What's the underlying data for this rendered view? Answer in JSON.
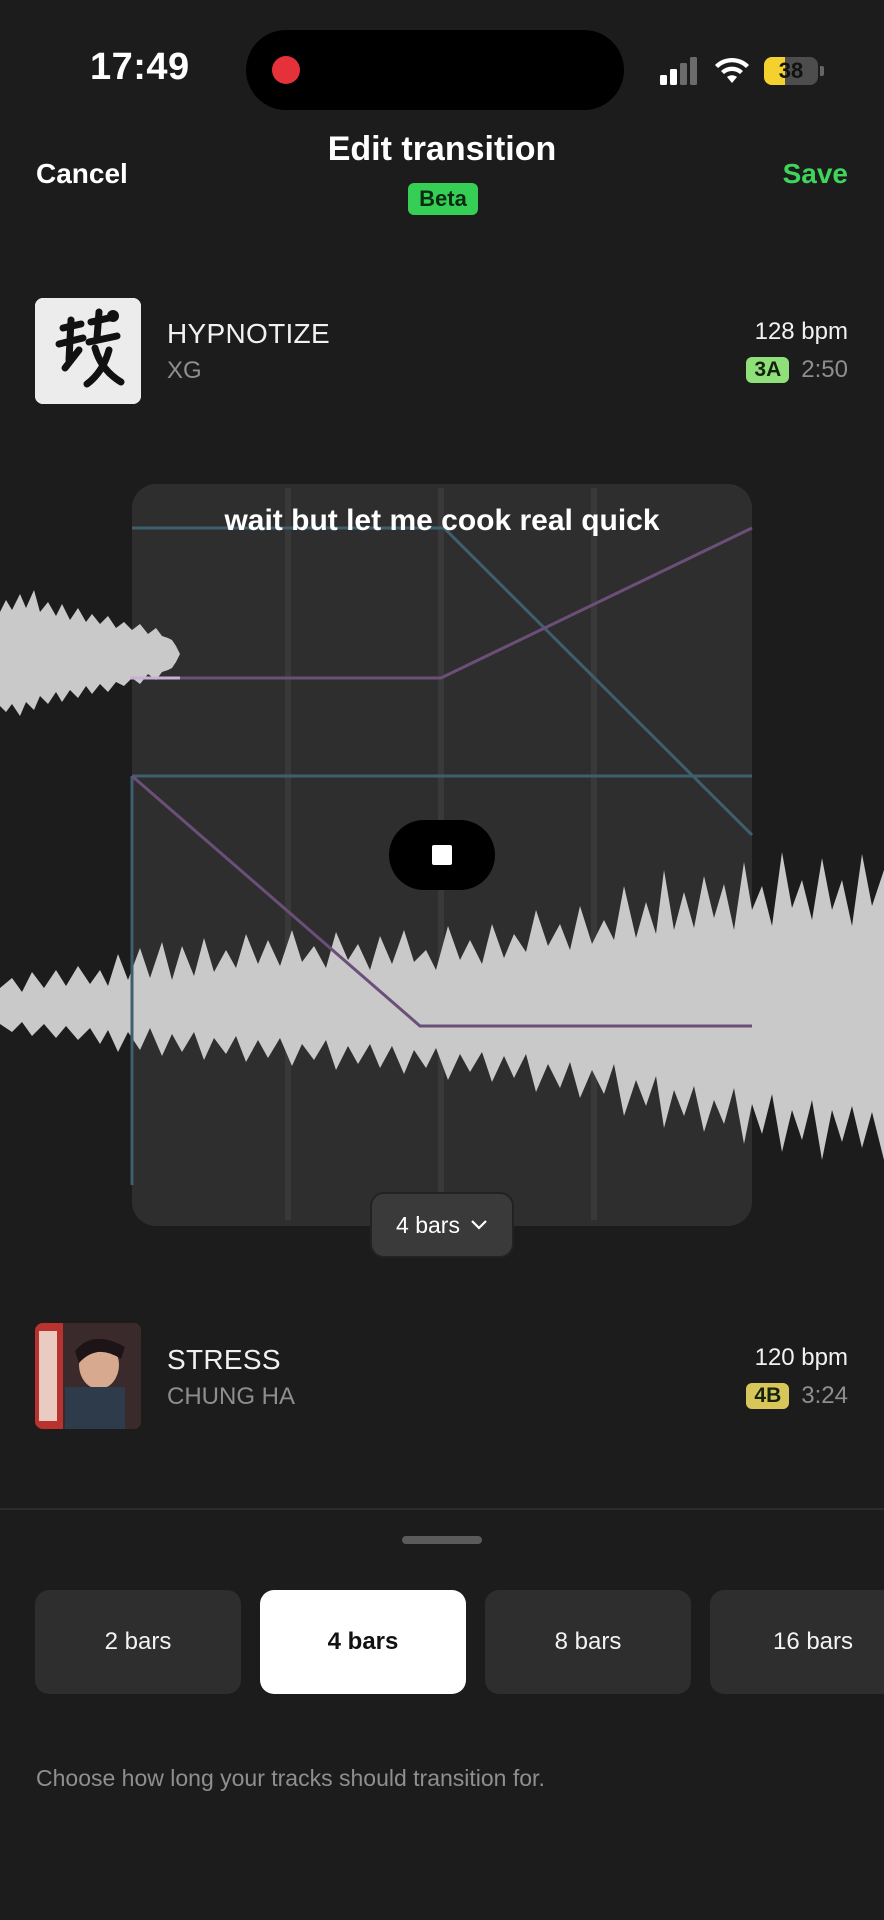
{
  "status_bar": {
    "time": "17:49",
    "battery": "38",
    "battery_level": 0.38,
    "recording": true
  },
  "header": {
    "cancel_label": "Cancel",
    "title": "Edit transition",
    "beta_label": "Beta",
    "save_label": "Save"
  },
  "tracks": {
    "from": {
      "name": "HYPNOTIZE",
      "artist": "XG",
      "bpm": "128 bpm",
      "key": "3A",
      "key_color": "#8fe07a",
      "duration": "2:50"
    },
    "to": {
      "name": "STRESS",
      "artist": "CHUNG HA",
      "bpm": "120 bpm",
      "key": "4B",
      "key_color": "#d8c65a",
      "duration": "3:24"
    }
  },
  "transition": {
    "lyric": "wait but let me cook real quick",
    "length_label": "4 bars",
    "dropdown_icon": "chevron-down-icon",
    "playback_icon": "stop-icon"
  },
  "length_options": [
    {
      "label": "2 bars",
      "selected": false
    },
    {
      "label": "4 bars",
      "selected": true
    },
    {
      "label": "8 bars",
      "selected": false
    },
    {
      "label": "16 bars",
      "selected": false
    }
  ],
  "hint": "Choose how long your tracks should transition for.",
  "colors": {
    "accent": "#3ed55a",
    "background": "#1c1c1c",
    "panel": "#2e2e2e",
    "automation_blue": "#3d5f6e",
    "automation_purple": "#6c4f78"
  }
}
